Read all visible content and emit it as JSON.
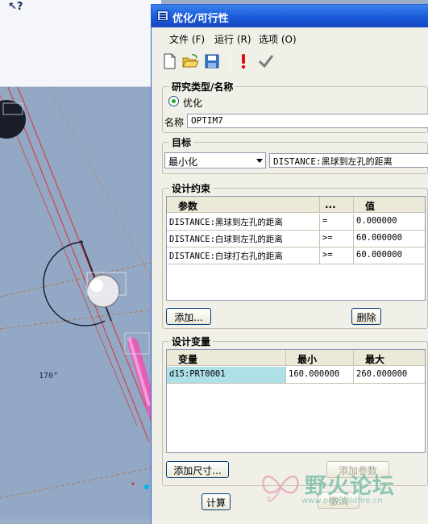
{
  "background_cad": {
    "angle_label": "170°"
  },
  "dialog": {
    "title": "优化/可行性",
    "menu": [
      "文件 (F)",
      "运行 (R)",
      "选项 (O)"
    ],
    "toolbar_icons": [
      "new-file-icon",
      "open-folder-icon",
      "save-icon",
      "exclamation-icon",
      "checkmark-icon"
    ],
    "study": {
      "title": "研究类型/名称",
      "radio_label": "优化",
      "name_label": "名称",
      "name_value": "OPTIM7"
    },
    "goal": {
      "title": "目标",
      "selected": "最小化",
      "target": "DISTANCE:黑球到左孔的距离"
    },
    "constraints": {
      "title": "设计约束",
      "columns": [
        "参数",
        "...",
        "值"
      ],
      "rows": [
        {
          "param": "DISTANCE:黑球到左孔的距离",
          "op": "=",
          "value": "0.000000"
        },
        {
          "param": "DISTANCE:白球到左孔的距离",
          "op": ">=",
          "value": "60.000000"
        },
        {
          "param": "DISTANCE:白球打右孔的距离",
          "op": ">=",
          "value": "60.000000"
        }
      ],
      "add_label": "添加...",
      "delete_label": "删除"
    },
    "variables": {
      "title": "设计变量",
      "columns": [
        "变量",
        "最小",
        "最大"
      ],
      "rows": [
        {
          "var": "d15:PRT0001",
          "min": "160.000000",
          "max": "260.000000"
        }
      ],
      "add_dim_label": "添加尺寸...",
      "add_param_label": "添加参数",
      "undo_label": "撤消"
    },
    "compute_label": "计算"
  },
  "watermark": {
    "text": "野火论坛",
    "url": "www.proewildfire.cn"
  },
  "colors": {
    "title_bar": "#1a58d8",
    "selection": "#aee0e8",
    "dialog_bg": "#f1f0e8",
    "exclamation": "#e01010"
  }
}
